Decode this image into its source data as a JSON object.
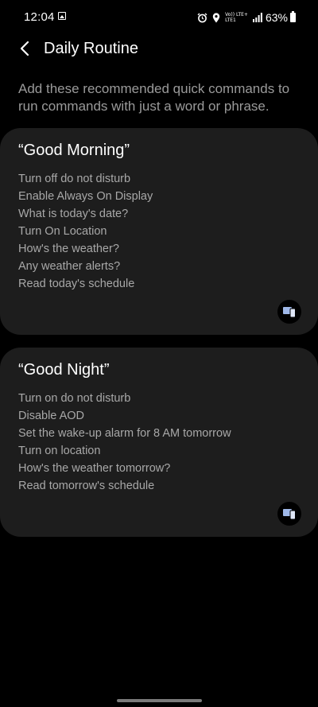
{
  "status_bar": {
    "time": "12:04",
    "network_line1": "Vo)) LTE+",
    "network_line2": "LTE1",
    "battery": "63%",
    "icons": [
      "gallery-icon",
      "alarm-icon",
      "location-icon",
      "signal-icon",
      "battery-icon"
    ]
  },
  "header": {
    "title": "Daily Routine",
    "back_icon": "chevron-left-icon"
  },
  "description": "Add these recommended quick commands to run commands with just a word or phrase.",
  "cards": [
    {
      "title": "“Good Morning”",
      "commands": [
        "Turn off do not disturb",
        "Enable Always On Display",
        "What is today's date?",
        "Turn On Location",
        "How's the weather?",
        "Any weather alerts?",
        "Read today's schedule"
      ],
      "device_icon": "phone-tablet-icon"
    },
    {
      "title": "“Good Night”",
      "commands": [
        "Turn on do not disturb",
        "Disable AOD",
        "Set the wake-up alarm for 8 AM tomorrow",
        "Turn on location",
        "How's the weather tomorrow?",
        "Read tomorrow's schedule"
      ],
      "device_icon": "phone-tablet-icon"
    }
  ],
  "colors": {
    "background": "#000000",
    "card": "#1d1d1d",
    "title_text": "#ffffff",
    "secondary_text": "#a8a8a8",
    "device_icon_accent": "#9fb8e8"
  }
}
